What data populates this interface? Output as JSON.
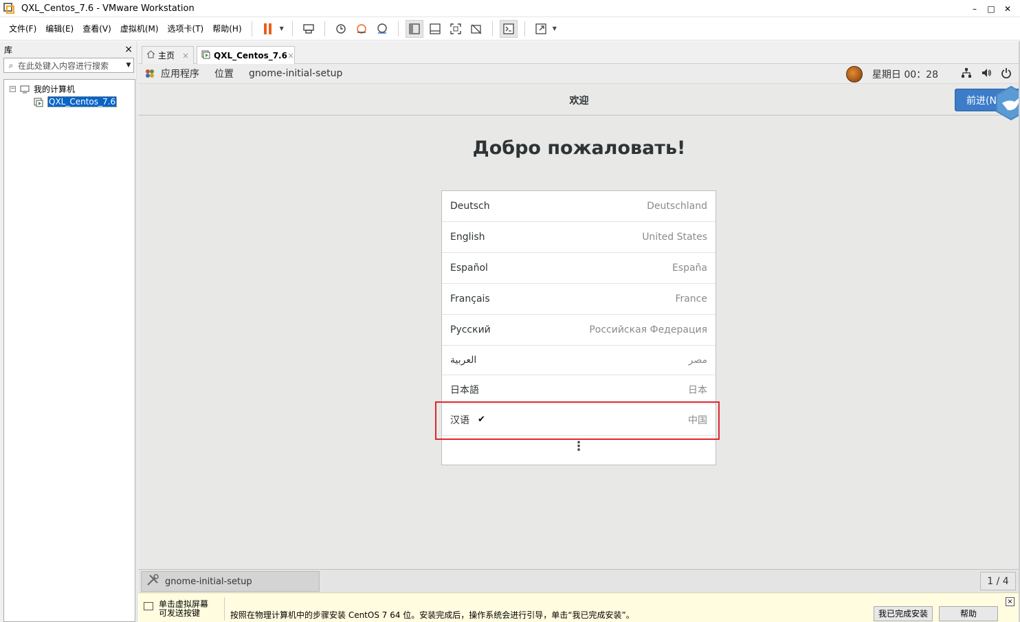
{
  "window": {
    "title": "QXL_Centos_7.6 - VMware Workstation",
    "minimize": "–",
    "maximize": "□",
    "close": "✕"
  },
  "menu": [
    "文件(F)",
    "编辑(E)",
    "查看(V)",
    "虚拟机(M)",
    "选项卡(T)",
    "帮助(H)"
  ],
  "library": {
    "title": "库",
    "close": "×",
    "search_placeholder": "在此处键入内容进行搜索",
    "tree": {
      "root": "我的计算机",
      "child": "QXL_Centos_7.6"
    }
  },
  "tabs": {
    "home": "主页",
    "vm": "QXL_Centos_7.6",
    "close": "×"
  },
  "gnome": {
    "applications": "应用程序",
    "places": "位置",
    "current_app": "gnome-initial-setup",
    "clock": "星期日 00：28"
  },
  "setup": {
    "header_title": "欢迎",
    "next_button": "前进(N)",
    "welcome": "Добро пожаловать!",
    "languages": [
      {
        "name": "Deutsch",
        "region": "Deutschland",
        "selected": false
      },
      {
        "name": "English",
        "region": "United States",
        "selected": false
      },
      {
        "name": "Español",
        "region": "España",
        "selected": false
      },
      {
        "name": "Français",
        "region": "France",
        "selected": false
      },
      {
        "name": "Русский",
        "region": "Российская Федерация",
        "selected": false
      },
      {
        "name": "العربية",
        "region": "مصر",
        "selected": false
      },
      {
        "name": "日本語",
        "region": "日本",
        "selected": false
      },
      {
        "name": "汉语",
        "region": "中国",
        "selected": true
      }
    ],
    "check": "✔",
    "more": "⋮"
  },
  "taskbar": {
    "item": "gnome-initial-setup",
    "pager": "1 / 4"
  },
  "hint": {
    "left_line1": "单击虚拟屏幕",
    "left_line2": "可发送按键",
    "text": "按照在物理计算机中的步骤安装 CentOS 7 64 位。安装完成后，操作系统会进行引导，单击“我已完成安装”。",
    "done_button": "我已完成安装",
    "help_button": "帮助",
    "close": "×"
  },
  "colors": {
    "accent": "#3d7cc9",
    "highlight_box": "#e0252e",
    "selection": "#0a64c8",
    "pause": "#e8601c"
  }
}
